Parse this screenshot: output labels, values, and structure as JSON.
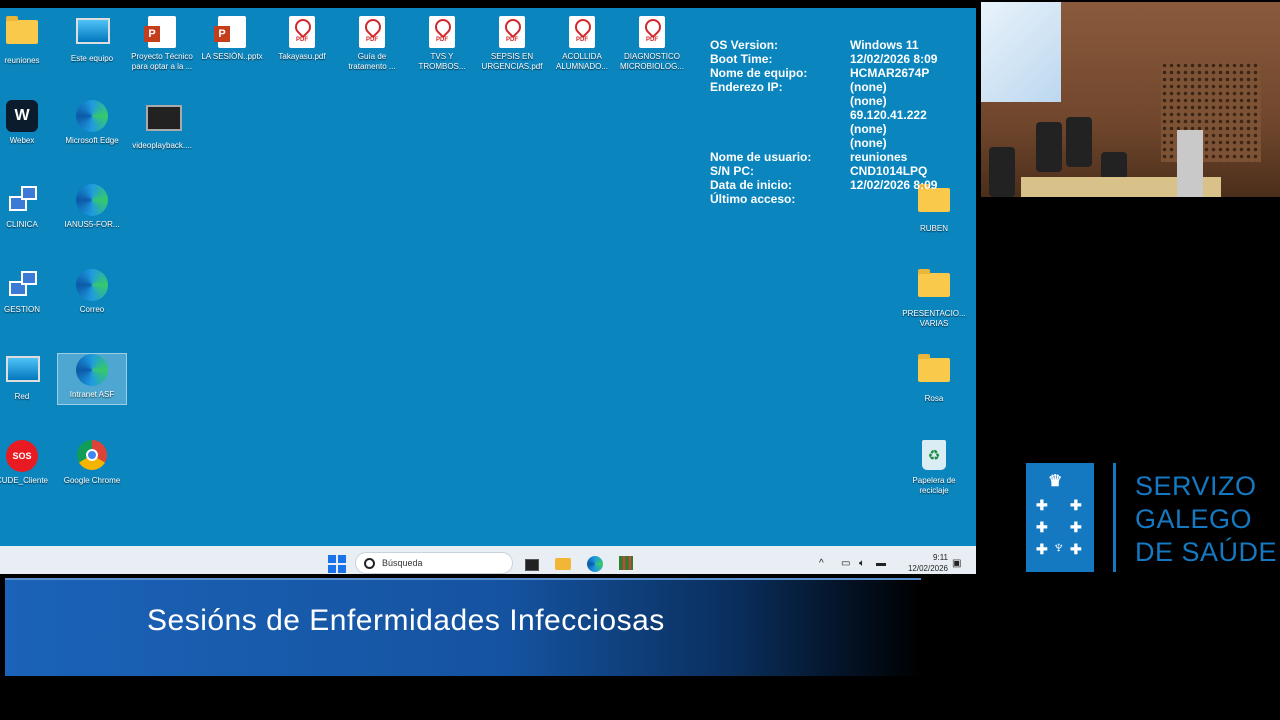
{
  "desktop": {
    "icons": [
      {
        "label": "reuniones"
      },
      {
        "label": "Este equipo"
      },
      {
        "label": "Proyecto Técnico para optar a la ..."
      },
      {
        "label": "LA SESIÓN..pptx"
      },
      {
        "label": "Takayasu.pdf"
      },
      {
        "label": "Guía de tratamento ..."
      },
      {
        "label": "TVS Y TROMBOS..."
      },
      {
        "label": "SEPSIS EN URGENCIAS.pdf"
      },
      {
        "label": "ACOLLIDA ALUMNADO..."
      },
      {
        "label": "DIAGNOSTICO MICROBIOLOG..."
      },
      {
        "label": "Webex"
      },
      {
        "label": "Microsoft Edge"
      },
      {
        "label": "videoplayback...."
      },
      {
        "label": "CLINICA"
      },
      {
        "label": "IANUS5-FOR..."
      },
      {
        "label": "GESTION"
      },
      {
        "label": "Correo"
      },
      {
        "label": "Red"
      },
      {
        "label": "Intranet ASF"
      },
      {
        "label": "CUDE_Cliente"
      },
      {
        "label": "Google Chrome"
      },
      {
        "label": "RUBEN"
      },
      {
        "label": "PRESENTACIO... VARIAS"
      },
      {
        "label": "Rosa"
      },
      {
        "label": "Papelera de reciclaje"
      }
    ],
    "pdf_badge": "PDF",
    "sos_badge": "SOS",
    "webex_badge": "W"
  },
  "sysinfo": [
    {
      "k": "OS Version:",
      "v": "Windows 11"
    },
    {
      "k": "Boot Time:",
      "v": "12/02/2026 8:09"
    },
    {
      "k": "Nome de equipo:",
      "v": "HCMAR2674P"
    },
    {
      "k": "Enderezo IP:",
      "v": "(none)"
    },
    {
      "k": "",
      "v": "(none)"
    },
    {
      "k": "",
      "v": "69.120.41.222"
    },
    {
      "k": "",
      "v": "(none)"
    },
    {
      "k": "",
      "v": "(none)"
    },
    {
      "k": "Nome de usuario:",
      "v": "reuniones"
    },
    {
      "k": "S/N PC:",
      "v": "CND1014LPQ"
    },
    {
      "k": "Data de inicio:",
      "v": "12/02/2026 8:09"
    },
    {
      "k": "Último acceso:",
      "v": ""
    }
  ],
  "taskbar": {
    "search_placeholder": "Búsqueda",
    "time": "9:11",
    "date": "12/02/2026"
  },
  "banner": {
    "title": "Sesións de Enfermidades Infecciosas"
  },
  "logo": {
    "line1": "SERVIZO",
    "line2": "GALEGO",
    "line3": "DE SAÚDE"
  },
  "colors": {
    "desktop": "#0a85be",
    "brand": "#1579c2",
    "taskbar": "#e8eef3"
  }
}
